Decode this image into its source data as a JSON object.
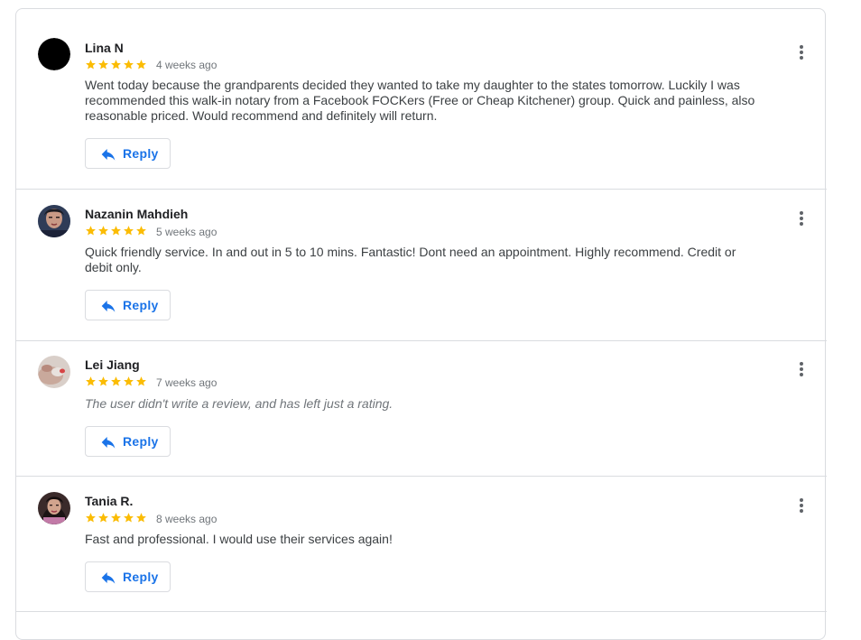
{
  "reviews": [
    {
      "name": "Lina N",
      "rating": 5,
      "date": "4 weeks ago",
      "text": "Went today because the grandparents decided they wanted to take my daughter to the states tomorrow. Luckily I was recommended this walk-in notary from a Facebook FOCKers (Free or Cheap Kitchener) group. Quick and painless, also reasonable priced. Would recommend and definitely will return.",
      "reply_label": "Reply",
      "avatar_icon": "black-circle-avatar"
    },
    {
      "name": "Nazanin Mahdieh",
      "rating": 5,
      "date": "5 weeks ago",
      "text": "Quick friendly service. In and out in 5 to 10 mins. Fantastic! Dont need an appointment. Highly recommend. Credit or debit only.",
      "reply_label": "Reply",
      "avatar_icon": "profile-photo"
    },
    {
      "name": "Lei Jiang",
      "rating": 5,
      "date": "7 weeks ago",
      "text": "The user didn't write a review, and has left just a rating.",
      "reply_label": "Reply",
      "avatar_icon": "profile-photo"
    },
    {
      "name": "Tania R.",
      "rating": 5,
      "date": "8 weeks ago",
      "text": "Fast and professional. I would use their services again!",
      "reply_label": "Reply",
      "avatar_icon": "profile-photo"
    }
  ],
  "colors": {
    "star": "#fbbc04",
    "link_blue": "#1a73e8",
    "divider": "#dadce0"
  }
}
